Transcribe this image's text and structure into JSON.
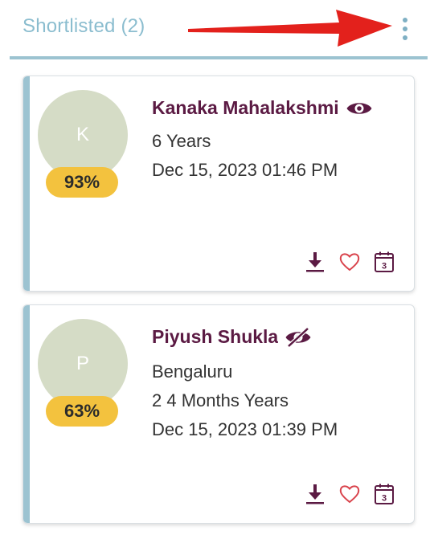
{
  "header": {
    "title": "Shortlisted (2)",
    "arrow_color": "#e3211c",
    "accent_color": "#9cc3d1"
  },
  "candidates": [
    {
      "initial": "K",
      "match": "93%",
      "name": "Kanaka Mahalakshmi",
      "viewed_icon": "eye-icon",
      "details": [
        "6 Years",
        "Dec 15, 2023 01:46 PM"
      ]
    },
    {
      "initial": "P",
      "match": "63%",
      "name": "Piyush Shukla",
      "viewed_icon": "eye-off-icon",
      "details": [
        "Bengaluru",
        "2 4 Months Years",
        "Dec 15, 2023 01:39 PM"
      ]
    }
  ],
  "actions": [
    "download-icon",
    "heart-icon",
    "calendar-icon"
  ],
  "colors": {
    "name": "#5b1a43",
    "badge": "#f3c23e",
    "avatar": "#d5dcc6",
    "heart": "#d9434c"
  }
}
